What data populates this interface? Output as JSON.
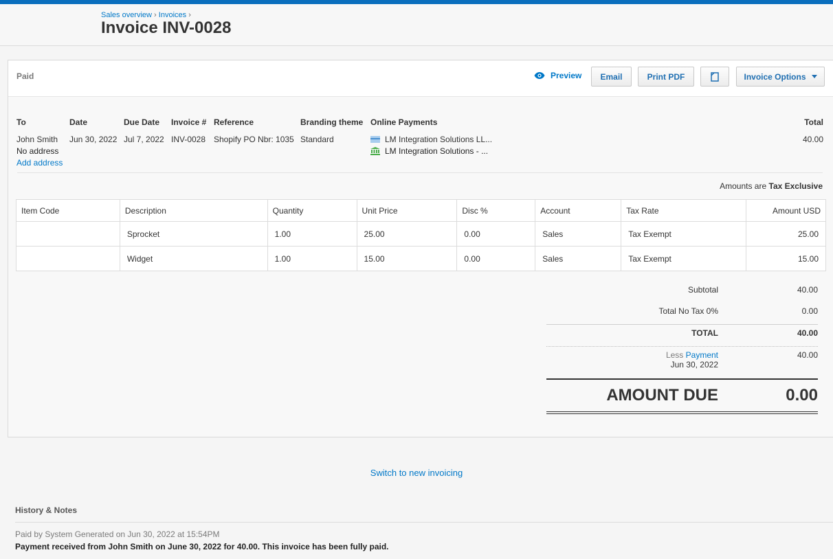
{
  "breadcrumbs": {
    "sales_overview": "Sales overview",
    "invoices": "Invoices",
    "sep": "›"
  },
  "page_title": "Invoice INV-0028",
  "status": "Paid",
  "toolbar": {
    "preview": "Preview",
    "email": "Email",
    "print_pdf": "Print PDF",
    "copy_icon": "copy-icon",
    "invoice_options": "Invoice Options"
  },
  "info": {
    "to_label": "To",
    "to_name": "John Smith",
    "to_address": "No address",
    "add_address": "Add address",
    "date_label": "Date",
    "date": "Jun 30, 2022",
    "due_label": "Due Date",
    "due": "Jul 7, 2022",
    "invoice_label": "Invoice #",
    "invoice_no": "INV-0028",
    "reference_label": "Reference",
    "reference": "Shopify PO Nbr: 1035",
    "branding_label": "Branding theme",
    "branding": "Standard",
    "online_label": "Online Payments",
    "online_1": "LM Integration Solutions LL...",
    "online_2": "LM Integration Solutions - ...",
    "total_label": "Total",
    "total": "40.00"
  },
  "tax_note": {
    "prefix": "Amounts are",
    "value": "Tax Exclusive"
  },
  "table": {
    "headers": [
      "Item Code",
      "Description",
      "Quantity",
      "Unit Price",
      "Disc %",
      "Account",
      "Tax Rate",
      "Amount USD"
    ],
    "rows": [
      [
        "",
        "Sprocket",
        "1.00",
        "25.00",
        "0.00",
        "Sales",
        "Tax Exempt",
        "25.00"
      ],
      [
        "",
        "Widget",
        "1.00",
        "15.00",
        "0.00",
        "Sales",
        "Tax Exempt",
        "15.00"
      ]
    ]
  },
  "totals": {
    "subtotal_label": "Subtotal",
    "subtotal": "40.00",
    "notax_label": "Total No Tax 0%",
    "notax": "0.00",
    "total_label": "TOTAL",
    "total": "40.00",
    "less_label": "Less",
    "payment_label": "Payment",
    "payment_date": "Jun 30, 2022",
    "payment": "40.00",
    "amount_due_label": "AMOUNT DUE",
    "amount_due": "0.00"
  },
  "switch_link": "Switch to new invoicing",
  "history": {
    "title": "History & Notes",
    "meta": "Paid by System Generated on Jun 30, 2022 at 15:54PM",
    "text": "Payment received from John Smith on June 30, 2022 for 40.00. This invoice has been fully paid."
  },
  "colors": {
    "accent": "#0078c8",
    "topbar": "#0a6ebd"
  }
}
